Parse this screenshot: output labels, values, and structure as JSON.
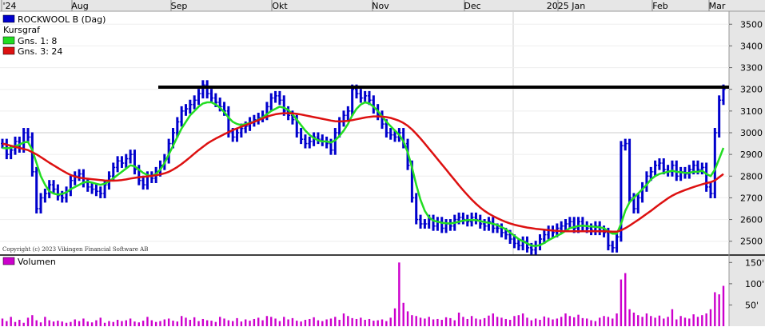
{
  "chart_data": [
    {
      "type": "ohlc",
      "title": "ROCKWOOL B (Dag)",
      "x_labels": [
        "'24",
        "Aug",
        "Sep",
        "Okt",
        "Nov",
        "Dec",
        "2025 Jan",
        "Feb",
        "Mar"
      ],
      "y_ticks": [
        "3500",
        "3400",
        "3300",
        "3200",
        "3100",
        "3000",
        "2900",
        "2800",
        "2700",
        "2600",
        "2500"
      ],
      "ylim": [
        2440,
        3560
      ],
      "legend": [
        {
          "label": "Kursgraf",
          "color": "#0000cc"
        },
        {
          "label": "Gns. 1: 8",
          "color": "#00cc00"
        },
        {
          "label": "Gns. 3: 24",
          "color": "#cc0000"
        }
      ],
      "horizontal_line": {
        "value": 3210,
        "color": "#000000"
      },
      "copyright": "Copyright (c) 2023 Vikingen Financial Software AB",
      "series": [
        {
          "name": "Kursgraf",
          "color": "#0000cc",
          "close": [
            2950,
            2900,
            2920,
            2960,
            2930,
            3000,
            2980,
            2820,
            2650,
            2700,
            2720,
            2760,
            2740,
            2710,
            2700,
            2730,
            2780,
            2800,
            2810,
            2770,
            2750,
            2740,
            2730,
            2720,
            2760,
            2800,
            2840,
            2870,
            2860,
            2880,
            2900,
            2830,
            2780,
            2760,
            2800,
            2790,
            2820,
            2850,
            2880,
            2950,
            3000,
            3050,
            3100,
            3110,
            3130,
            3150,
            3180,
            3220,
            3180,
            3160,
            3140,
            3120,
            3100,
            3000,
            2980,
            3000,
            3020,
            3030,
            3050,
            3060,
            3070,
            3080,
            3120,
            3160,
            3170,
            3150,
            3100,
            3080,
            3060,
            3000,
            2970,
            2950,
            2960,
            2980,
            2970,
            2960,
            2950,
            2920,
            3000,
            3050,
            3080,
            3100,
            3200,
            3180,
            3160,
            3170,
            3150,
            3110,
            3080,
            3040,
            3000,
            2990,
            2980,
            3000,
            2950,
            2850,
            2700,
            2600,
            2580,
            2580,
            2600,
            2570,
            2590,
            2560,
            2580,
            2570,
            2600,
            2610,
            2600,
            2590,
            2610,
            2600,
            2580,
            2570,
            2590,
            2560,
            2560,
            2540,
            2530,
            2510,
            2490,
            2480,
            2500,
            2470,
            2460,
            2480,
            2510,
            2530,
            2550,
            2540,
            2560,
            2570,
            2580,
            2590,
            2560,
            2590,
            2570,
            2560,
            2550,
            2570,
            2550,
            2540,
            2480,
            2470,
            2520,
            2940,
            2950,
            2700,
            2650,
            2700,
            2750,
            2800,
            2820,
            2850,
            2860,
            2830,
            2820,
            2850,
            2800,
            2820,
            2810,
            2830,
            2850,
            2830,
            2840,
            2750,
            2720,
            3000,
            3150,
            3200
          ]
        },
        {
          "name": "Gns. 1: 8",
          "color": "#22dd22",
          "values": [
            2930,
            2928,
            2930,
            2938,
            2945,
            2955,
            2958,
            2920,
            2860,
            2800,
            2760,
            2730,
            2720,
            2715,
            2718,
            2725,
            2740,
            2750,
            2760,
            2770,
            2775,
            2770,
            2765,
            2760,
            2765,
            2775,
            2790,
            2805,
            2820,
            2835,
            2850,
            2845,
            2830,
            2815,
            2805,
            2800,
            2810,
            2830,
            2860,
            2900,
            2940,
            2980,
            3020,
            3050,
            3080,
            3100,
            3120,
            3135,
            3140,
            3140,
            3130,
            3115,
            3095,
            3070,
            3050,
            3040,
            3035,
            3040,
            3045,
            3050,
            3060,
            3070,
            3085,
            3100,
            3110,
            3120,
            3115,
            3105,
            3085,
            3060,
            3035,
            3010,
            2990,
            2975,
            2965,
            2960,
            2960,
            2955,
            2965,
            2985,
            3010,
            3040,
            3080,
            3110,
            3130,
            3140,
            3135,
            3120,
            3100,
            3075,
            3050,
            3030,
            3010,
            2990,
            2960,
            2910,
            2840,
            2760,
            2690,
            2640,
            2610,
            2595,
            2590,
            2585,
            2583,
            2582,
            2585,
            2590,
            2595,
            2597,
            2598,
            2597,
            2593,
            2588,
            2585,
            2580,
            2575,
            2565,
            2555,
            2540,
            2525,
            2510,
            2500,
            2490,
            2480,
            2478,
            2482,
            2492,
            2505,
            2515,
            2525,
            2535,
            2548,
            2560,
            2565,
            2570,
            2572,
            2570,
            2568,
            2566,
            2564,
            2560,
            2545,
            2535,
            2535,
            2580,
            2640,
            2680,
            2700,
            2720,
            2740,
            2760,
            2785,
            2800,
            2810,
            2815,
            2820,
            2825,
            2820,
            2818,
            2815,
            2815,
            2820,
            2820,
            2825,
            2810,
            2800,
            2830,
            2880,
            2930
          ]
        },
        {
          "name": "Gns. 3: 24",
          "color": "#dd1111",
          "values": [
            2950,
            2945,
            2940,
            2935,
            2930,
            2925,
            2920,
            2910,
            2900,
            2888,
            2875,
            2862,
            2850,
            2838,
            2826,
            2815,
            2805,
            2798,
            2793,
            2790,
            2788,
            2786,
            2784,
            2782,
            2780,
            2779,
            2779,
            2780,
            2782,
            2785,
            2789,
            2792,
            2795,
            2797,
            2799,
            2801,
            2804,
            2808,
            2813,
            2820,
            2830,
            2842,
            2856,
            2871,
            2887,
            2904,
            2920,
            2935,
            2950,
            2962,
            2973,
            2983,
            2993,
            3003,
            3012,
            3020,
            3028,
            3035,
            3042,
            3050,
            3058,
            3066,
            3074,
            3080,
            3085,
            3088,
            3090,
            3090,
            3089,
            3087,
            3084,
            3080,
            3076,
            3072,
            3068,
            3064,
            3060,
            3056,
            3053,
            3052,
            3053,
            3055,
            3058,
            3062,
            3066,
            3070,
            3073,
            3075,
            3075,
            3074,
            3072,
            3068,
            3062,
            3055,
            3045,
            3032,
            3015,
            2995,
            2973,
            2950,
            2926,
            2902,
            2878,
            2854,
            2830,
            2806,
            2782,
            2758,
            2735,
            2713,
            2692,
            2673,
            2655,
            2640,
            2627,
            2616,
            2606,
            2597,
            2589,
            2582,
            2576,
            2571,
            2567,
            2563,
            2560,
            2557,
            2555,
            2553,
            2551,
            2549,
            2548,
            2547,
            2546,
            2546,
            2546,
            2546,
            2546,
            2546,
            2546,
            2546,
            2546,
            2546,
            2545,
            2544,
            2544,
            2550,
            2560,
            2572,
            2585,
            2598,
            2612,
            2626,
            2640,
            2655,
            2670,
            2684,
            2698,
            2710,
            2720,
            2728,
            2736,
            2743,
            2750,
            2756,
            2762,
            2768,
            2772,
            2780,
            2795,
            2810
          ]
        }
      ]
    },
    {
      "type": "bar",
      "title": "Volumen",
      "legend_color": "#cc00cc",
      "y_ticks": [
        "150'",
        "100'",
        "50'"
      ],
      "ylim": [
        0,
        160
      ],
      "values": [
        18,
        12,
        22,
        10,
        15,
        8,
        20,
        26,
        14,
        9,
        22,
        14,
        11,
        13,
        11,
        8,
        10,
        16,
        12,
        18,
        11,
        9,
        14,
        20,
        8,
        12,
        10,
        15,
        12,
        14,
        18,
        11,
        9,
        13,
        22,
        14,
        10,
        12,
        16,
        18,
        13,
        11,
        24,
        20,
        15,
        21,
        12,
        17,
        14,
        13,
        10,
        22,
        18,
        14,
        12,
        19,
        11,
        16,
        13,
        17,
        20,
        14,
        24,
        22,
        18,
        12,
        22,
        16,
        19,
        13,
        11,
        15,
        17,
        21,
        14,
        12,
        16,
        18,
        22,
        15,
        30,
        24,
        19,
        17,
        20,
        15,
        17,
        13,
        14,
        16,
        12,
        20,
        42,
        150,
        55,
        35,
        26,
        24,
        20,
        18,
        22,
        16,
        17,
        15,
        21,
        19,
        14,
        32,
        22,
        17,
        24,
        18,
        16,
        19,
        25,
        30,
        22,
        20,
        17,
        15,
        24,
        26,
        30,
        20,
        14,
        18,
        15,
        23,
        20,
        16,
        18,
        22,
        30,
        24,
        21,
        27,
        19,
        18,
        14,
        12,
        20,
        24,
        22,
        18,
        30,
        110,
        125,
        40,
        32,
        26,
        22,
        30,
        24,
        20,
        25,
        18,
        22,
        40,
        16,
        24,
        20,
        18,
        28,
        22,
        26,
        30,
        40,
        80,
        75,
        95
      ]
    }
  ]
}
